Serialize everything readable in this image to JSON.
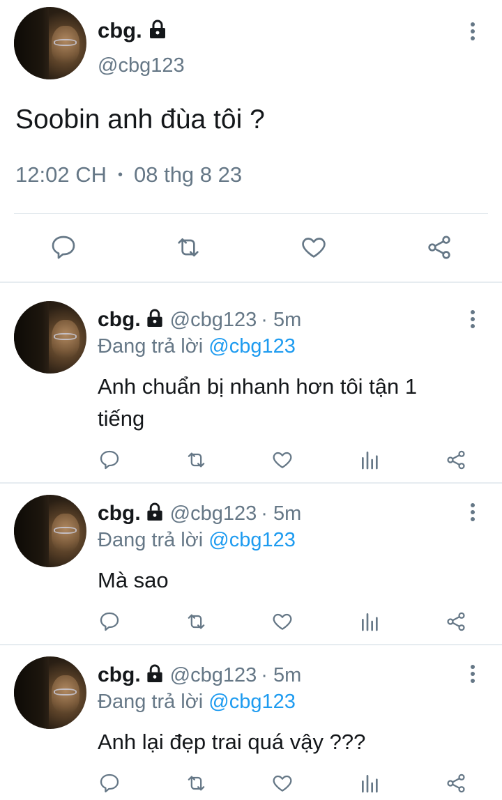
{
  "main_tweet": {
    "name": "cbg.",
    "handle": "@cbg123",
    "text": "Soobin anh đùa tôi ?",
    "time": "12:02 CH",
    "separator": "•",
    "date": "08 thg 8 23",
    "icons": [
      "reply-icon",
      "retweet-icon",
      "like-icon",
      "share-icon"
    ]
  },
  "replies": [
    {
      "name": "cbg.",
      "handle": "@cbg123",
      "meta": "· 5m",
      "replying_prefix": "Đang trả lời",
      "replying_to": "@cbg123",
      "text_line1": "Anh chuẩn bị nhanh hơn tôi tận 1",
      "text_line2": "tiếng"
    },
    {
      "name": "cbg.",
      "handle": "@cbg123",
      "meta": "· 5m",
      "replying_prefix": "Đang trả lời",
      "replying_to": "@cbg123",
      "text_line1": "Mà sao",
      "text_line2": ""
    },
    {
      "name": "cbg.",
      "handle": "@cbg123",
      "meta": "· 5m",
      "replying_prefix": "Đang trả lời",
      "replying_to": "@cbg123",
      "text_line1": "Anh lại đẹp trai quá vậy ???",
      "text_line2": ""
    }
  ],
  "colors": {
    "accent_link": "#1d9bf0",
    "secondary_text": "#657786",
    "icon_gray": "#657786",
    "divider": "#e1e8ed"
  }
}
